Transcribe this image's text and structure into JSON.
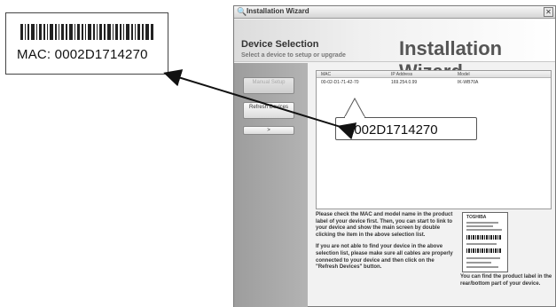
{
  "label": {
    "mac_text": "MAC: 0002D1714270"
  },
  "window": {
    "title": "Installation Wizard",
    "close_glyph": "✕",
    "icon_glyph": "🔍"
  },
  "header": {
    "section_title": "Device Selection",
    "section_subtitle": "Select a device to setup or upgrade",
    "banner": "Installation Wizard"
  },
  "sidebar": {
    "manual_setup": "Manual Setup",
    "refresh_devices": "Refresh Devices",
    "next": ">"
  },
  "device_table": {
    "columns": [
      "MAC",
      "IP Address",
      "Model"
    ],
    "rows": [
      [
        "00-02-D1-71-42-70",
        "169.254.0.99",
        "IK-WB70A"
      ]
    ]
  },
  "tooltip": {
    "text": "0002D1714270"
  },
  "instructions": {
    "para1": "Please check the MAC and model name in the product label of your device first. Then, you can start to link to your device and show the main screen by double clicking the item in the above selection list.",
    "para2": "If you are not able to find your device in the above selection list, please make sure all cables are properly connected to your device and then click on the \"Refresh Devices\" button."
  },
  "product_label": {
    "brand": "TOSHIBA"
  },
  "label_hint": "You can find the product label in the rear/bottom part of your device."
}
